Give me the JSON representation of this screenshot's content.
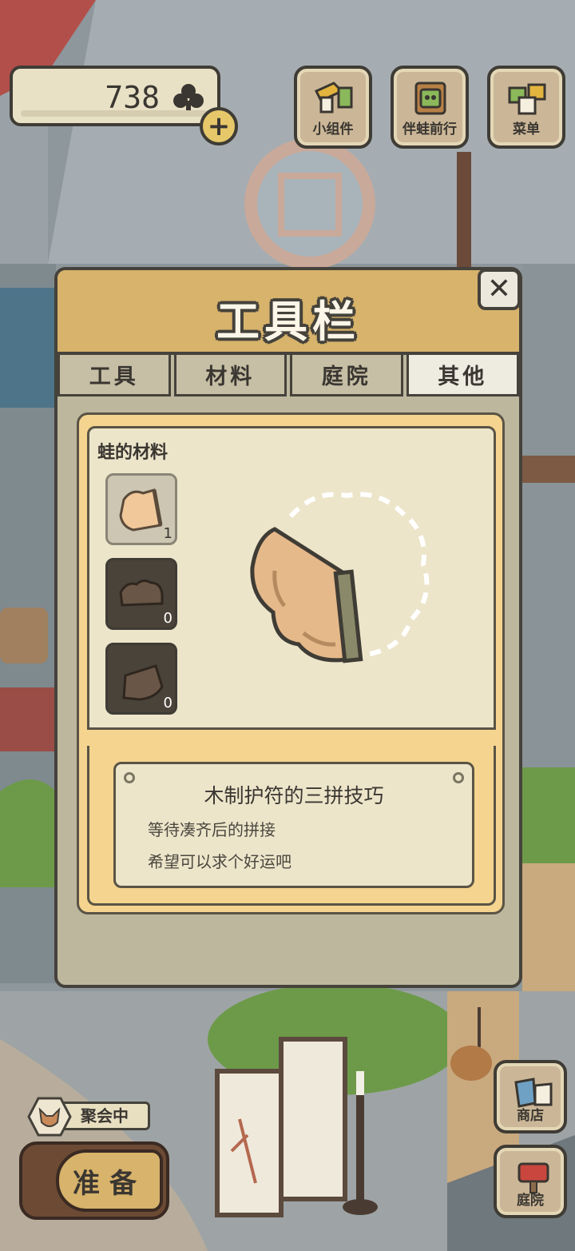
{
  "counter": {
    "value": "738",
    "currency_icon": "clover-icon",
    "add_icon": "plus-icon"
  },
  "top_buttons": [
    {
      "label": "小组件",
      "icon": "widget-icon"
    },
    {
      "label": "伴蛙前行",
      "icon": "photo-album-icon"
    },
    {
      "label": "菜单",
      "icon": "menu-cards-icon"
    }
  ],
  "modal": {
    "title": "工具栏",
    "close_icon": "close-icon",
    "tabs": [
      {
        "label": "工具",
        "active": false
      },
      {
        "label": "材料",
        "active": false
      },
      {
        "label": "庭院",
        "active": false
      },
      {
        "label": "其他",
        "active": true
      }
    ],
    "section_title": "蛙的材料",
    "items": [
      {
        "icon": "wood-piece-1-icon",
        "qty": "1",
        "selected": true
      },
      {
        "icon": "wood-piece-2-icon",
        "qty": "0",
        "selected": false
      },
      {
        "icon": "wood-piece-3-icon",
        "qty": "0",
        "selected": false
      }
    ],
    "preview_icon": "wooden-charm-piece-icon",
    "description": {
      "title": "木制护符的三拼技巧",
      "line1": "等待凑齐后的拼接",
      "line2": "希望可以求个好运吧"
    }
  },
  "bottom": {
    "party_status": "聚会中",
    "party_icon": "fox-icon",
    "ready_button": "准备"
  },
  "side_buttons": [
    {
      "label": "商店",
      "icon": "shop-bags-icon"
    },
    {
      "label": "庭院",
      "icon": "garden-mailbox-icon"
    }
  ]
}
